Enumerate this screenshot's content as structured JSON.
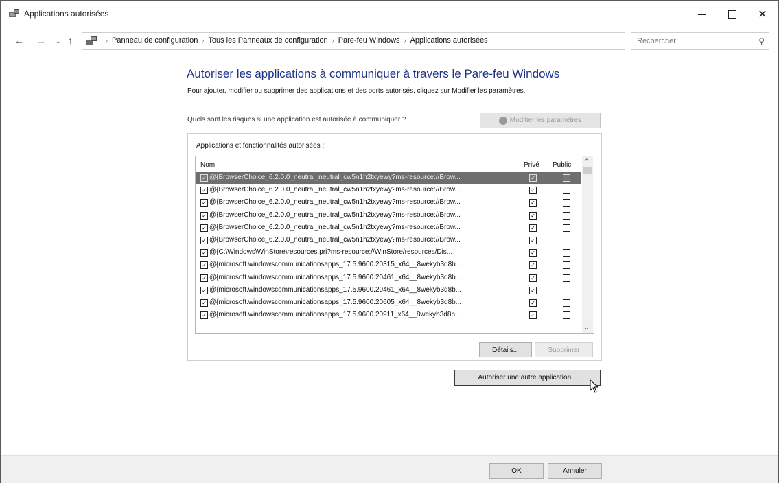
{
  "window": {
    "title": "Applications autorisées",
    "controls": {
      "minimize": "minimize",
      "maximize": "maximize",
      "close": "✕"
    }
  },
  "nav": {
    "breadcrumbs": [
      "Panneau de configuration",
      "Tous les Panneaux de configuration",
      "Pare-feu Windows",
      "Applications autorisées"
    ],
    "search_placeholder": "Rechercher"
  },
  "content": {
    "heading": "Autoriser les applications à communiquer à travers le Pare-feu Windows",
    "description": "Pour ajouter, modifier ou supprimer des applications et des ports autorisés, cliquez sur Modifier les paramètres.",
    "risk_link": "Quels sont les risques si une application est autorisée à communiquer ?",
    "modify_button": "Modifier les paramètres",
    "group_label": "Applications et fonctionnalités autorisées :",
    "columns": {
      "name": "Nom",
      "private": "Privé",
      "public": "Public"
    },
    "rows": [
      {
        "name": "@{BrowserChoice_6.2.0.0_neutral_neutral_cw5n1h2txyewy?ms-resource://Brow...",
        "enabled": true,
        "private": true,
        "public": false,
        "selected": true
      },
      {
        "name": "@{BrowserChoice_6.2.0.0_neutral_neutral_cw5n1h2txyewy?ms-resource://Brow...",
        "enabled": true,
        "private": true,
        "public": false,
        "selected": false
      },
      {
        "name": "@{BrowserChoice_6.2.0.0_neutral_neutral_cw5n1h2txyewy?ms-resource://Brow...",
        "enabled": true,
        "private": true,
        "public": false,
        "selected": false
      },
      {
        "name": "@{BrowserChoice_6.2.0.0_neutral_neutral_cw5n1h2txyewy?ms-resource://Brow...",
        "enabled": true,
        "private": true,
        "public": false,
        "selected": false
      },
      {
        "name": "@{BrowserChoice_6.2.0.0_neutral_neutral_cw5n1h2txyewy?ms-resource://Brow...",
        "enabled": true,
        "private": true,
        "public": false,
        "selected": false
      },
      {
        "name": "@{BrowserChoice_6.2.0.0_neutral_neutral_cw5n1h2txyewy?ms-resource://Brow...",
        "enabled": true,
        "private": true,
        "public": false,
        "selected": false
      },
      {
        "name": "@{C:\\Windows\\WinStore\\resources.pri?ms-resource://WinStore/resources/Dis...",
        "enabled": true,
        "private": true,
        "public": false,
        "selected": false
      },
      {
        "name": "@{microsoft.windowscommunicationsapps_17.5.9600.20315_x64__8wekyb3d8b...",
        "enabled": true,
        "private": true,
        "public": false,
        "selected": false
      },
      {
        "name": "@{microsoft.windowscommunicationsapps_17.5.9600.20461_x64__8wekyb3d8b...",
        "enabled": true,
        "private": true,
        "public": false,
        "selected": false
      },
      {
        "name": "@{microsoft.windowscommunicationsapps_17.5.9600.20461_x64__8wekyb3d8b...",
        "enabled": true,
        "private": true,
        "public": false,
        "selected": false
      },
      {
        "name": "@{microsoft.windowscommunicationsapps_17.5.9600.20605_x64__8wekyb3d8b...",
        "enabled": true,
        "private": true,
        "public": false,
        "selected": false
      },
      {
        "name": "@{microsoft.windowscommunicationsapps_17.5.9600.20911_x64__8wekyb3d8b...",
        "enabled": true,
        "private": true,
        "public": false,
        "selected": false
      }
    ],
    "details_button": "Détails...",
    "delete_button": "Supprimer",
    "allow_other_button": "Autoriser une autre application..."
  },
  "footer": {
    "ok": "OK",
    "cancel": "Annuler"
  },
  "colors": {
    "heading": "#1e3287",
    "selected_row": "#6e6e6e",
    "footer_bg": "#f0f0f0"
  }
}
